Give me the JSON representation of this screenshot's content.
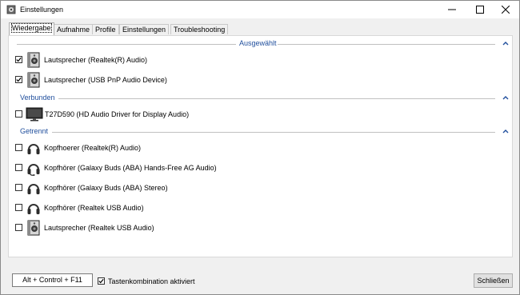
{
  "window": {
    "title": "Einstellungen"
  },
  "tabs": [
    "Wiedergabe",
    "Aufnahme",
    "Profile",
    "Einstellungen",
    "Troubleshooting"
  ],
  "groups": {
    "selected": {
      "label": "Ausgewählt",
      "items": [
        {
          "label": "Lautsprecher (Realtek(R) Audio)",
          "checked": true,
          "icon": "speaker-icon"
        },
        {
          "label": "Lautsprecher (USB PnP Audio Device)",
          "checked": true,
          "icon": "speaker-icon"
        }
      ]
    },
    "connected": {
      "label": "Verbunden",
      "items": [
        {
          "label": "T27D590 (HD Audio Driver for Display Audio)",
          "checked": false,
          "icon": "monitor-icon"
        }
      ]
    },
    "disconnected": {
      "label": "Getrennt",
      "items": [
        {
          "label": "Kopfhoerer (Realtek(R) Audio)",
          "checked": false,
          "icon": "headphones-icon"
        },
        {
          "label": "Kopfhörer (Galaxy Buds (ABA) Hands-Free AG Audio)",
          "checked": false,
          "icon": "headset-icon"
        },
        {
          "label": "Kopfhörer (Galaxy Buds (ABA) Stereo)",
          "checked": false,
          "icon": "headphones-icon"
        },
        {
          "label": "Kopfhörer (Realtek USB Audio)",
          "checked": false,
          "icon": "headphones-icon"
        },
        {
          "label": "Lautsprecher (Realtek USB Audio)",
          "checked": false,
          "icon": "speaker-icon"
        }
      ]
    }
  },
  "footer": {
    "hotkey": "Alt + Control + F11",
    "hotkey_enabled_label": "Tastenkombination aktiviert",
    "hotkey_enabled": true,
    "close_label": "Schließen"
  }
}
